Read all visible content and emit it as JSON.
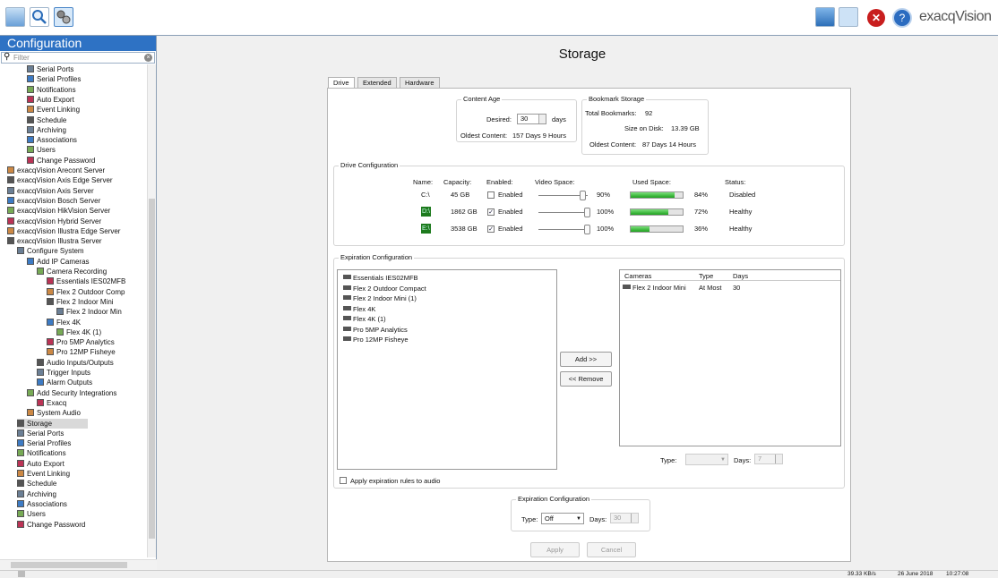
{
  "toolbar": {
    "brand": "exacqVision"
  },
  "sidebar": {
    "title": "Configuration",
    "filter_placeholder": "Filter",
    "items": [
      {
        "label": "Serial Ports",
        "indent": 2
      },
      {
        "label": "Serial Profiles",
        "indent": 2
      },
      {
        "label": "Notifications",
        "indent": 2
      },
      {
        "label": "Auto Export",
        "indent": 2
      },
      {
        "label": "Event Linking",
        "indent": 2
      },
      {
        "label": "Schedule",
        "indent": 2
      },
      {
        "label": "Archiving",
        "indent": 2
      },
      {
        "label": "Associations",
        "indent": 2
      },
      {
        "label": "Users",
        "indent": 2
      },
      {
        "label": "Change Password",
        "indent": 2
      },
      {
        "label": "exacqVision Arecont Server",
        "indent": 0
      },
      {
        "label": "exacqVision Axis Edge Server",
        "indent": 0
      },
      {
        "label": "exacqVision Axis Server",
        "indent": 0
      },
      {
        "label": "exacqVision Bosch Server",
        "indent": 0
      },
      {
        "label": "exacqVision HikVision Server",
        "indent": 0
      },
      {
        "label": "exacqVision Hybrid Server",
        "indent": 0
      },
      {
        "label": "exacqVision Illustra Edge Server",
        "indent": 0
      },
      {
        "label": "exacqVision Illustra Server",
        "indent": 0
      },
      {
        "label": "Configure System",
        "indent": 1
      },
      {
        "label": "Add IP Cameras",
        "indent": 2
      },
      {
        "label": "Camera Recording",
        "indent": 3
      },
      {
        "label": "Essentials IES02MFB",
        "indent": 4
      },
      {
        "label": "Flex 2 Outdoor Comp",
        "indent": 4
      },
      {
        "label": "Flex 2 Indoor Mini",
        "indent": 4
      },
      {
        "label": "Flex 2 Indoor Min",
        "indent": 5
      },
      {
        "label": "Flex 4K",
        "indent": 4
      },
      {
        "label": "Flex 4K (1)",
        "indent": 5
      },
      {
        "label": "Pro 5MP Analytics",
        "indent": 4
      },
      {
        "label": "Pro 12MP Fisheye",
        "indent": 4
      },
      {
        "label": "Audio Inputs/Outputs",
        "indent": 3
      },
      {
        "label": "Trigger Inputs",
        "indent": 3
      },
      {
        "label": "Alarm Outputs",
        "indent": 3
      },
      {
        "label": "Add Security Integrations",
        "indent": 2
      },
      {
        "label": "Exacq",
        "indent": 3
      },
      {
        "label": "System Audio",
        "indent": 2
      },
      {
        "label": "Storage",
        "indent": 1,
        "selected": true
      },
      {
        "label": "Serial Ports",
        "indent": 1
      },
      {
        "label": "Serial Profiles",
        "indent": 1
      },
      {
        "label": "Notifications",
        "indent": 1
      },
      {
        "label": "Auto Export",
        "indent": 1
      },
      {
        "label": "Event Linking",
        "indent": 1
      },
      {
        "label": "Schedule",
        "indent": 1
      },
      {
        "label": "Archiving",
        "indent": 1
      },
      {
        "label": "Associations",
        "indent": 1
      },
      {
        "label": "Users",
        "indent": 1
      },
      {
        "label": "Change Password",
        "indent": 1
      }
    ]
  },
  "main": {
    "title": "Storage",
    "tabs": [
      "Drive",
      "Extended",
      "Hardware"
    ],
    "content_age": {
      "title": "Content Age",
      "desired_label": "Desired:",
      "desired_value": "30",
      "desired_unit": "days",
      "oldest_label": "Oldest Content:",
      "oldest_value": "157 Days 9 Hours"
    },
    "bookmark": {
      "title": "Bookmark Storage",
      "total_label": "Total Bookmarks:",
      "total_value": "92",
      "size_label": "Size on Disk:",
      "size_value": "13.39 GB",
      "oldest_label": "Oldest Content:",
      "oldest_value": "87 Days 14 Hours"
    },
    "drive_config": {
      "title": "Drive Configuration",
      "headers": {
        "name": "Name:",
        "capacity": "Capacity:",
        "enabled": "Enabled:",
        "video": "Video Space:",
        "used": "Used Space:",
        "status": "Status:"
      },
      "enabled_label": "Enabled",
      "rows": [
        {
          "name": "C:\\",
          "capacity": "45 GB",
          "checked": false,
          "video_pct": "90%",
          "video": 0.9,
          "used_pct": "84%",
          "used": 0.84,
          "status": "Disabled",
          "badge": false
        },
        {
          "name": "D:\\",
          "capacity": "1862 GB",
          "checked": true,
          "video_pct": "100%",
          "video": 1.0,
          "used_pct": "72%",
          "used": 0.72,
          "status": "Healthy",
          "badge": true
        },
        {
          "name": "E:\\",
          "capacity": "3538 GB",
          "checked": true,
          "video_pct": "100%",
          "video": 1.0,
          "used_pct": "36%",
          "used": 0.36,
          "status": "Healthy",
          "badge": true
        }
      ]
    },
    "expiration": {
      "title": "Expiration Configuration",
      "cameras": [
        "Essentials IES02MFB",
        "Flex 2 Outdoor Compact",
        "Flex 2 Indoor Mini (1)",
        "Flex 4K",
        "Flex 4K (1)",
        "Pro 5MP Analytics",
        "Pro 12MP Fisheye"
      ],
      "add_label": "Add >>",
      "remove_label": "<< Remove",
      "table_headers": {
        "cameras": "Cameras",
        "type": "Type",
        "days": "Days"
      },
      "table_rows": [
        {
          "camera": "Flex 2 Indoor Mini",
          "type": "At Most",
          "days": "30"
        }
      ],
      "type_label": "Type:",
      "type_value": "",
      "days_label": "Days:",
      "days_value": "7",
      "audio_label": "Apply expiration rules to audio"
    },
    "exp_bottom": {
      "title": "Expiration Configuration",
      "type_label": "Type:",
      "type_value": "Off",
      "days_label": "Days:",
      "days_value": "30"
    },
    "apply_label": "Apply",
    "cancel_label": "Cancel"
  },
  "statusbar": {
    "rate": "39.33 KB/s",
    "date": "26 June 2018",
    "time": "10:27:08"
  }
}
